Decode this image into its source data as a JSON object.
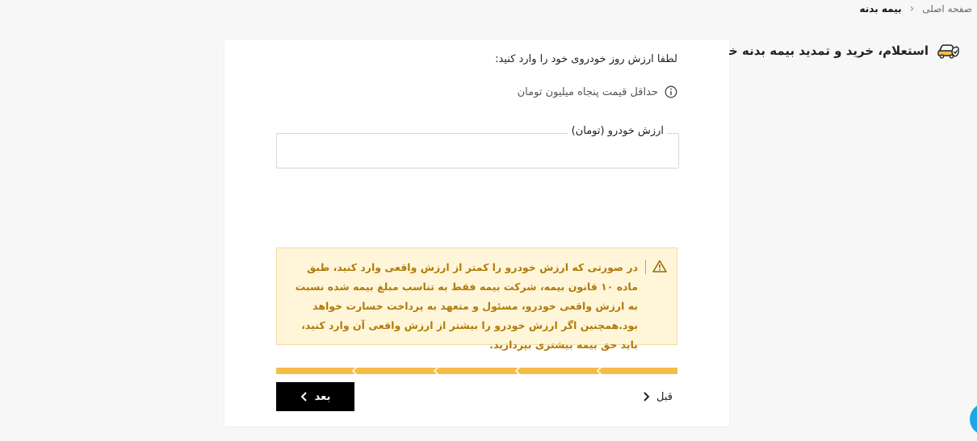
{
  "breadcrumb": {
    "home": "صفحه اصلی",
    "separator": "‹",
    "current": "بیمه بدنه"
  },
  "page": {
    "title": "استعلام، خرید و تمدید بیمه بدنه خودرو"
  },
  "form": {
    "prompt": "لطفا ارزش روز خودروی خود را وارد کنید:",
    "hint": "حداقل قیمت پنجاه میلیون تومان",
    "field_label": "ارزش خودرو (تومان)",
    "field_value": ""
  },
  "warning": {
    "text": "در صورتی که ارزش خودرو را کمتر از ارزش واقعی وارد کنید، طبق ماده ۱۰ قانون بیمه، شرکت بیمه فقط به تناسب مبلغ بیمه شده نسبت به ارزش واقعی خودرو، مسئول و متعهد به پرداخت خسارت خواهد بود.همچنین اگر ارزش خودرو را بیشتر از ارزش واقعی آن وارد کنید، باید حق بیمه بیشتری بپردازید."
  },
  "nav": {
    "next_label": "بعد",
    "prev_label": "قبل"
  },
  "colors": {
    "accent": "#f5bd47",
    "warning_bg": "#fff6da",
    "warning_text": "#b07b0c",
    "primary_button": "#000000",
    "fab": "#1aa7e6"
  }
}
